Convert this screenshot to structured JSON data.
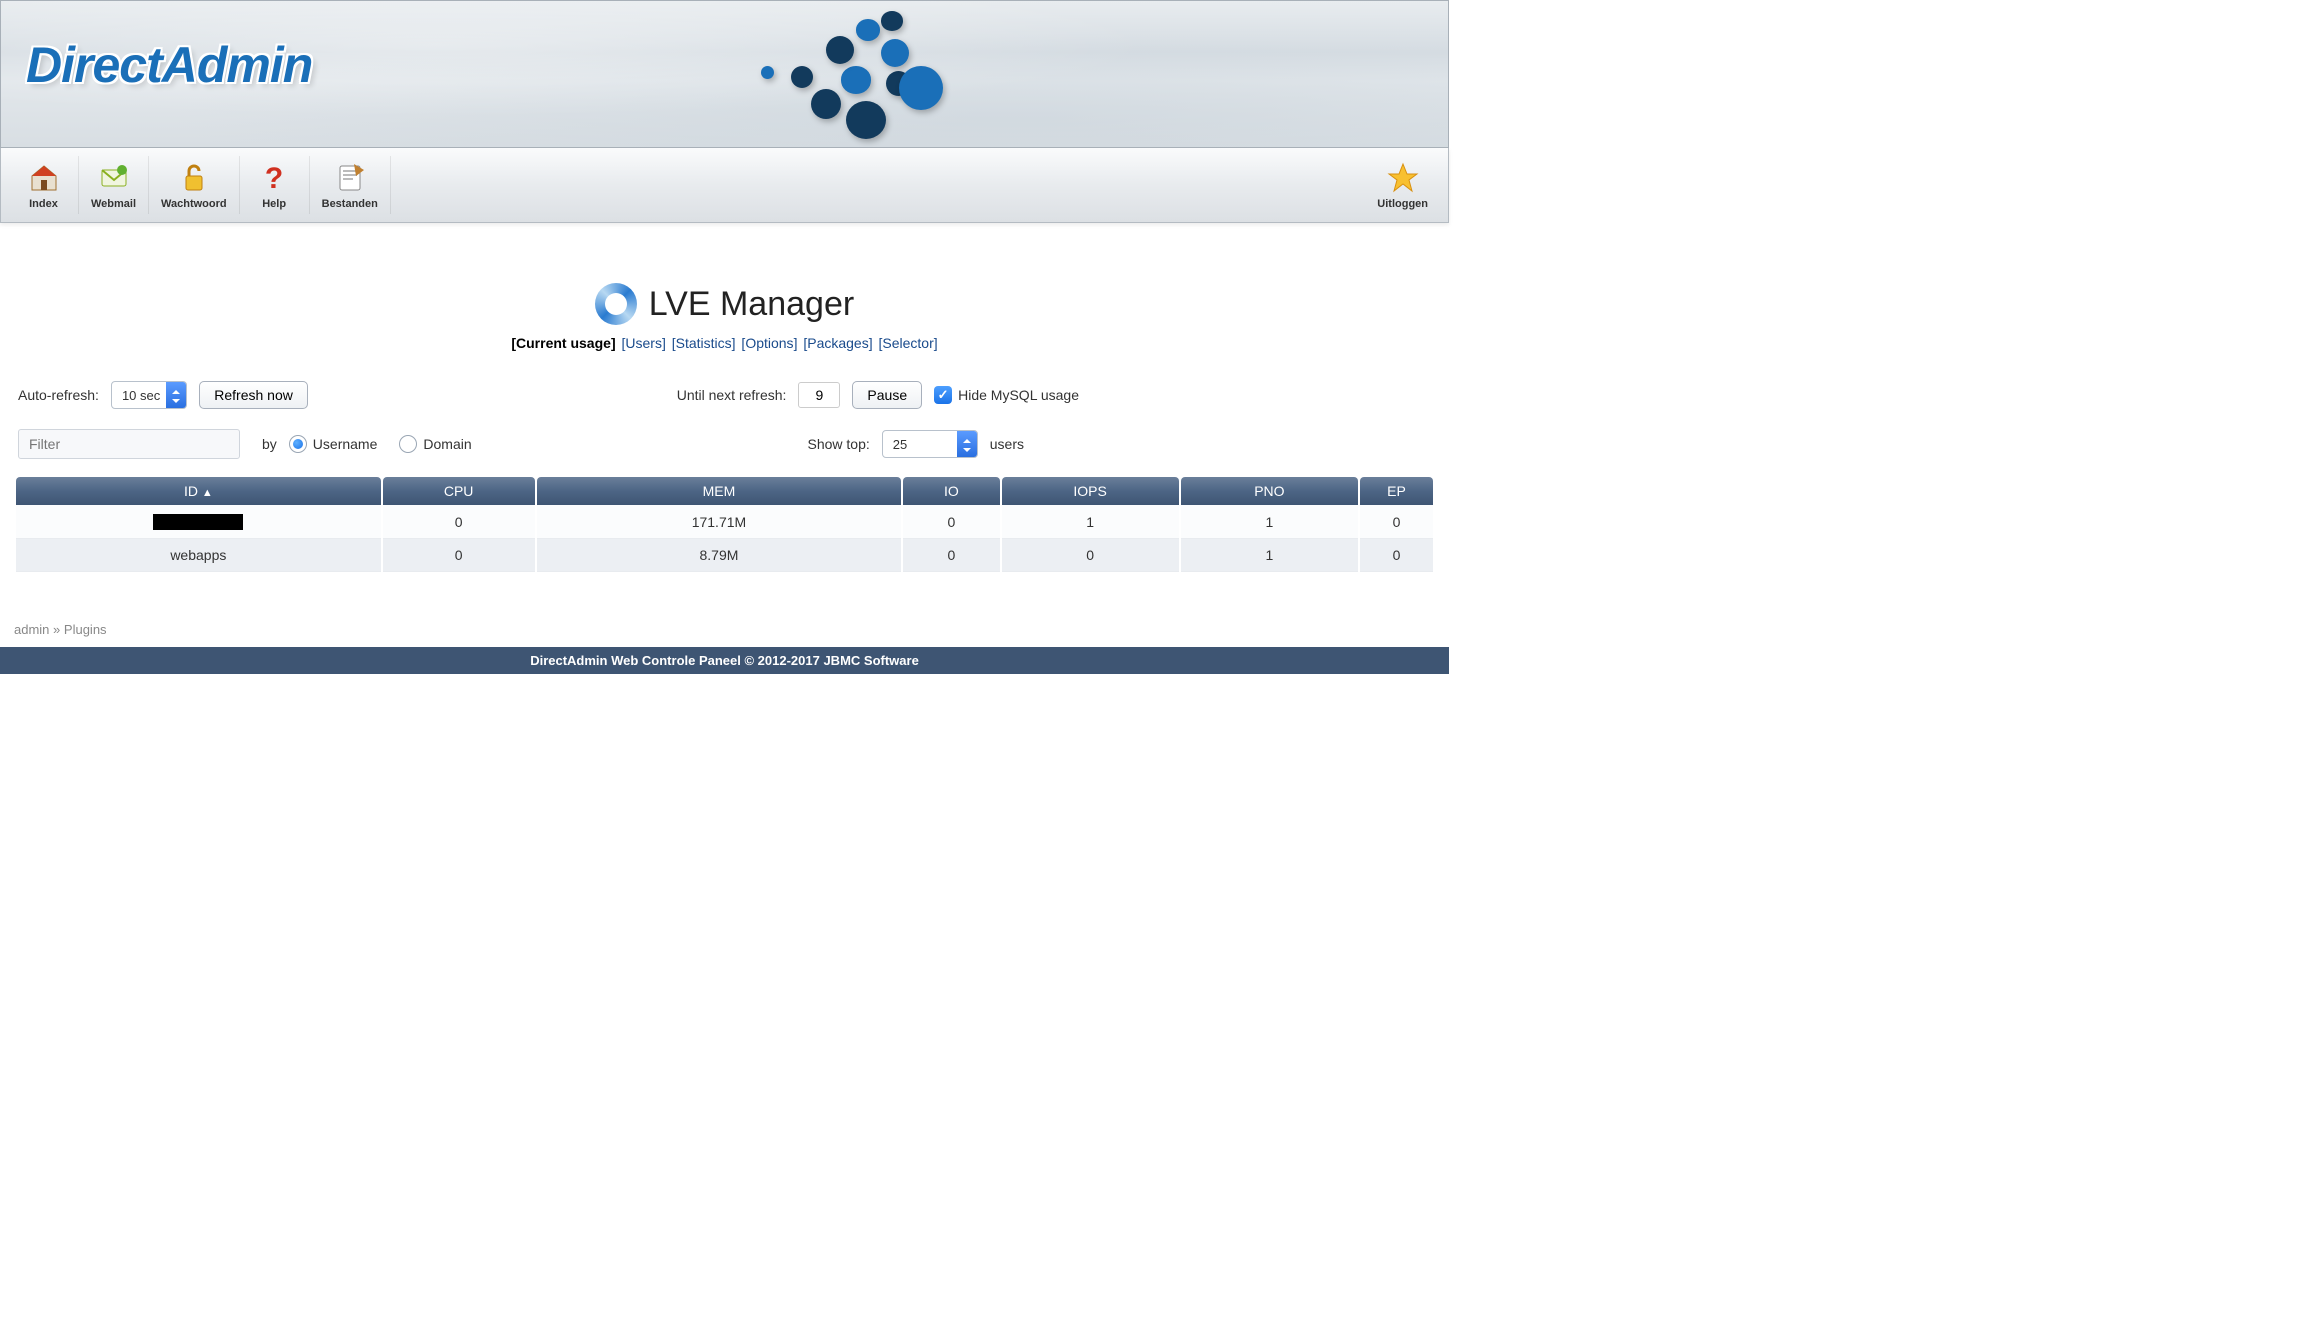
{
  "logo_text": "DirectAdmin",
  "toolbar": [
    {
      "icon": "home",
      "label": "Index"
    },
    {
      "icon": "mail",
      "label": "Webmail"
    },
    {
      "icon": "lock",
      "label": "Wachtwoord"
    },
    {
      "icon": "help",
      "label": "Help"
    },
    {
      "icon": "files",
      "label": "Bestanden"
    }
  ],
  "toolbar_logout": {
    "icon": "star",
    "label": "Uitloggen"
  },
  "page": {
    "title": "LVE Manager",
    "tabs": [
      {
        "label": "Current usage",
        "active": true
      },
      {
        "label": "Users"
      },
      {
        "label": "Statistics"
      },
      {
        "label": "Options"
      },
      {
        "label": "Packages"
      },
      {
        "label": "Selector"
      }
    ]
  },
  "controls": {
    "auto_refresh_label": "Auto-refresh:",
    "auto_refresh_value": "10 sec",
    "refresh_button": "Refresh now",
    "until_next_label": "Until next refresh:",
    "until_next_value": "9",
    "pause_button": "Pause",
    "hide_mysql_label": "Hide MySQL usage",
    "hide_mysql_checked": true,
    "filter_placeholder": "Filter",
    "by_label": "by",
    "radio_username": "Username",
    "radio_domain": "Domain",
    "radio_selected": "username",
    "show_top_label": "Show top:",
    "show_top_value": "25",
    "users_label": "users"
  },
  "table": {
    "columns": [
      "ID",
      "CPU",
      "MEM",
      "IO",
      "IOPS",
      "PNO",
      "EP"
    ],
    "sort_column": "ID",
    "sort_dir": "asc",
    "col_widths": [
      "360px",
      "150px",
      "360px",
      "95px",
      "175px",
      "175px",
      "72px"
    ],
    "rows": [
      {
        "id_redacted": true,
        "id": "",
        "cpu": "0",
        "mem": "171.71M",
        "io": "0",
        "iops": "1",
        "pno": "1",
        "ep": "0"
      },
      {
        "id_redacted": false,
        "id": "webapps",
        "cpu": "0",
        "mem": "8.79M",
        "io": "0",
        "iops": "0",
        "pno": "1",
        "ep": "0"
      }
    ]
  },
  "breadcrumb": {
    "home": "admin",
    "sep": "»",
    "current": "Plugins"
  },
  "footer": "DirectAdmin Web Controle Paneel © 2012-2017 JBMC Software"
}
